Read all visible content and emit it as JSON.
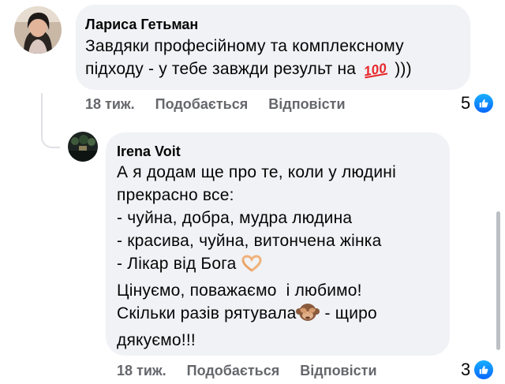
{
  "comments": [
    {
      "author": "Лариса Гетьман",
      "text_line1": "Завдяки професійному та комплексному",
      "text_line2_before": "підходу - у тебе завжди результ на",
      "text_line2_emoji": "100-points-emoji",
      "text_line2_after": ")))",
      "time": "18 тиж.",
      "like_label": "Подобається",
      "reply_label": "Відповісти",
      "reaction_count": "5",
      "reaction_icon": "like-icon"
    },
    {
      "author": "Irena Voit",
      "lines": [
        "А я додам ще про те, коли у людині",
        "прекрасно все:",
        "- чуйна, добра, мудра людина",
        "- красива, чуйна, витончена жінка"
      ],
      "line5_before": "- Лікар від Бога",
      "line5_emoji": "heart-hands-emoji",
      "line6": "Цінуємо, поважаємо  і любимо!",
      "line7_before": "Скільки разів рятувала",
      "line7_emoji": "see-no-evil-monkey-emoji",
      "line7_after": " - щиро",
      "line8": "дякуємо!!!",
      "time": "18 тиж.",
      "like_label": "Подобається",
      "reply_label": "Відповісти",
      "reaction_count": "3",
      "reaction_icon": "like-icon"
    }
  ],
  "colors": {
    "bubble": "#f0f2f5",
    "meta_text": "#65676b",
    "like_blue": "#0866ff"
  }
}
